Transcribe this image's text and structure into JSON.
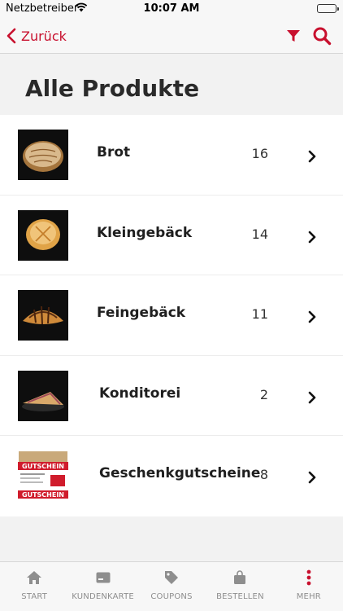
{
  "status": {
    "carrier": "Netzbetreiber",
    "time": "10:07 AM"
  },
  "nav": {
    "back_label": "Zurück"
  },
  "page": {
    "title": "Alle Produkte"
  },
  "colors": {
    "accent": "#c8102e"
  },
  "products": [
    {
      "name": "Brot",
      "count": "16"
    },
    {
      "name": "Kleingebäck",
      "count": "14"
    },
    {
      "name": "Feingebäck",
      "count": "11"
    },
    {
      "name": "Konditorei",
      "count": "2"
    },
    {
      "name": "Geschenkgutscheine",
      "count": "8"
    }
  ],
  "voucher_text": "GUTSCHEIN",
  "tabs": [
    {
      "label": "START",
      "icon": "home-icon"
    },
    {
      "label": "KUNDENKARTE",
      "icon": "card-icon"
    },
    {
      "label": "COUPONS",
      "icon": "tag-icon"
    },
    {
      "label": "BESTELLEN",
      "icon": "bag-icon"
    },
    {
      "label": "MEHR",
      "icon": "more-icon"
    }
  ]
}
